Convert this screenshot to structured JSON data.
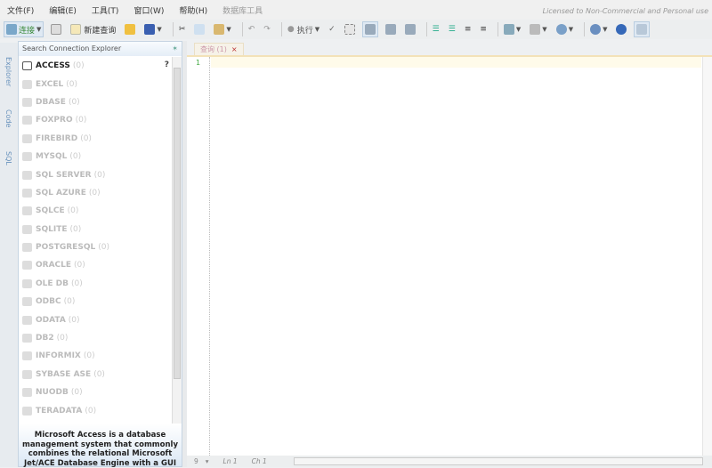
{
  "menu": [
    "文件(F)",
    "编辑(E)",
    "工具(T)",
    "窗口(W)",
    "帮助(H)",
    "数据库工具"
  ],
  "license": "Licensed to Non-Commercial and Personal use",
  "toolbar": {
    "connect": "连接",
    "new_query": "新建查询",
    "execute": "执行"
  },
  "side_tabs": [
    "Explorer",
    "Code",
    "SQL"
  ],
  "explorer": {
    "search_placeholder": "Search Connection Explorer",
    "help": "?",
    "items": [
      {
        "name": "ACCESS",
        "count": "(0)"
      },
      {
        "name": "EXCEL",
        "count": "(0)"
      },
      {
        "name": "DBASE",
        "count": "(0)"
      },
      {
        "name": "FOXPRO",
        "count": "(0)"
      },
      {
        "name": "FIREBIRD",
        "count": "(0)"
      },
      {
        "name": "MYSQL",
        "count": "(0)"
      },
      {
        "name": "SQL SERVER",
        "count": "(0)"
      },
      {
        "name": "SQL AZURE",
        "count": "(0)"
      },
      {
        "name": "SQLCE",
        "count": "(0)"
      },
      {
        "name": "SQLITE",
        "count": "(0)"
      },
      {
        "name": "POSTGRESQL",
        "count": "(0)"
      },
      {
        "name": "ORACLE",
        "count": "(0)"
      },
      {
        "name": "OLE DB",
        "count": "(0)"
      },
      {
        "name": "ODBC",
        "count": "(0)"
      },
      {
        "name": "ODATA",
        "count": "(0)"
      },
      {
        "name": "DB2",
        "count": "(0)"
      },
      {
        "name": "INFORMIX",
        "count": "(0)"
      },
      {
        "name": "SYBASE ASE",
        "count": "(0)"
      },
      {
        "name": "NUODB",
        "count": "(0)"
      },
      {
        "name": "TERADATA",
        "count": "(0)"
      }
    ],
    "description": "Microsoft Access is a database management system that commonly combines the relational Microsoft Jet/ACE Database Engine with a GUI"
  },
  "editor": {
    "tab": "查询 (1)",
    "line_number": "1"
  },
  "status": {
    "zoom": "9",
    "ln": "Ln 1",
    "ch": "Ch 1"
  }
}
